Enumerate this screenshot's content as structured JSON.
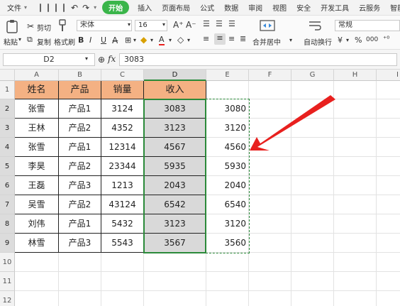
{
  "menu": {
    "file": "文件",
    "tabs": [
      "开始",
      "插入",
      "页面布局",
      "公式",
      "数据",
      "审阅",
      "视图",
      "安全",
      "开发工具",
      "云服务",
      "智能"
    ],
    "active_tab": "开始"
  },
  "ribbon": {
    "paste": "粘贴",
    "cut": "剪切",
    "copy": "复制",
    "format_painter": "格式刷",
    "font_name": "宋体",
    "font_size": "16",
    "bold": "B",
    "italic": "I",
    "underline": "U",
    "merge_center": "合并居中",
    "auto_wrap": "自动换行",
    "number_format": "常规",
    "currency_symbol": "¥",
    "percent_symbol": "%",
    "thousands_symbol": "000"
  },
  "formula_bar": {
    "name_box": "D2",
    "fx": "fx",
    "value": "3083"
  },
  "sheet": {
    "columns": [
      "A",
      "B",
      "C",
      "D",
      "E",
      "F",
      "G",
      "H",
      "I"
    ],
    "selected_column": "D",
    "rows": [
      "1",
      "2",
      "3",
      "4",
      "5",
      "6",
      "7",
      "8",
      "9",
      "10",
      "11",
      "12"
    ],
    "header": [
      "姓名",
      "产品",
      "销量",
      "收入"
    ],
    "data": [
      {
        "name": "张雪",
        "product": "产品1",
        "sales": "3124",
        "income": "3083",
        "e": "3080"
      },
      {
        "name": "王林",
        "product": "产品2",
        "sales": "4352",
        "income": "3123",
        "e": "3120"
      },
      {
        "name": "张雪",
        "product": "产品1",
        "sales": "12314",
        "income": "4567",
        "e": "4560"
      },
      {
        "name": "李昊",
        "product": "产品2",
        "sales": "23344",
        "income": "5935",
        "e": "5930"
      },
      {
        "name": "王磊",
        "product": "产品3",
        "sales": "1213",
        "income": "2043",
        "e": "2040"
      },
      {
        "name": "吴雪",
        "product": "产品2",
        "sales": "43124",
        "income": "6542",
        "e": "6540"
      },
      {
        "name": "刘伟",
        "product": "产品1",
        "sales": "5432",
        "income": "3123",
        "e": "3120"
      },
      {
        "name": "林雪",
        "product": "产品3",
        "sales": "5543",
        "income": "3567",
        "e": "3560"
      }
    ]
  },
  "colors": {
    "accent_green": "#3ab54a",
    "header_fill": "#f4b183",
    "arrow_red": "#e8201e",
    "selection_green": "#2b8a3a"
  }
}
